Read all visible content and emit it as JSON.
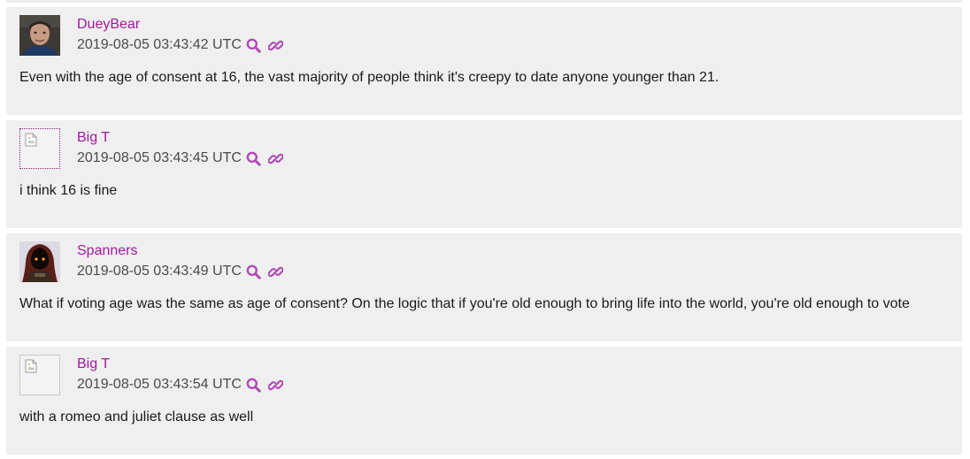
{
  "theme": {
    "accent": "#a0199c",
    "icon_color": "#b04ab8",
    "post_background": "#efefef",
    "text_color": "#1a1a1a",
    "timestamp_color": "#4a4a4a"
  },
  "posts": [
    {
      "author": "DueyBear",
      "timestamp": "2019-08-05 03:43:42 UTC",
      "avatar": "photo-avatar",
      "body": "Even with the age of consent at 16, the vast majority of people think it's creepy to date anyone younger than 21."
    },
    {
      "author": "Big T",
      "timestamp": "2019-08-05 03:43:45 UTC",
      "avatar": "broken-image-icon",
      "body": "i think 16 is fine"
    },
    {
      "author": "Spanners",
      "timestamp": "2019-08-05 03:43:49 UTC",
      "avatar": "hooded-figure-avatar",
      "body": "What if voting age was the same as age of consent? On the logic that if you're old enough to bring life into the world, you're old enough to vote"
    },
    {
      "author": "Big T",
      "timestamp": "2019-08-05 03:43:54 UTC",
      "avatar": "broken-image-icon",
      "body": "with a romeo and juliet clause as well"
    }
  ],
  "icons": {
    "search": "search-icon",
    "permalink": "link-icon"
  }
}
